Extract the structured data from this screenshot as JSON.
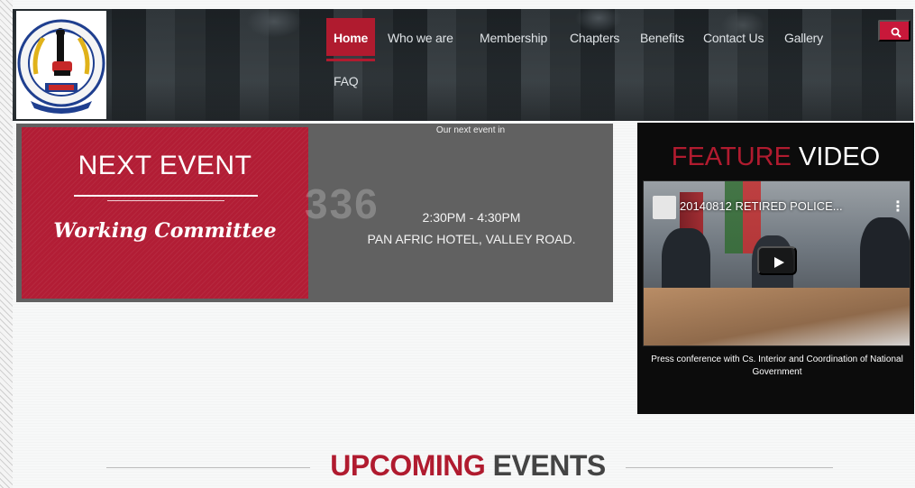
{
  "brand": {
    "logo_ring_text": "NATIONAL ASSOCIATION OF RETIRED POLICE OFFICERS",
    "logo_country": "KENYA",
    "logo_motto": "Utu Usalama"
  },
  "nav": {
    "items": [
      {
        "label": "Home",
        "active": true
      },
      {
        "label": "Who we are"
      },
      {
        "label": "Membership"
      },
      {
        "label": "Chapters"
      },
      {
        "label": "Benefits"
      },
      {
        "label": "Contact Us"
      },
      {
        "label": "Gallery"
      },
      {
        "label": "FAQ"
      }
    ],
    "search_icon": "search-icon"
  },
  "next_event": {
    "title": "NEXT EVENT",
    "name": "Working Committee",
    "caption": "Our next event in",
    "countdown": "336",
    "time": "2:30PM - 4:30PM",
    "venue": "PAN AFRIC HOTEL, VALLEY ROAD."
  },
  "feature_video": {
    "title_part1": "FEATURE",
    "title_part2": "VIDEO",
    "video_title": "20140812 RETIRED POLICE...",
    "menu_icon": "⋮",
    "caption": "Press conference with Cs. Interior and Coordination of National Government"
  },
  "upcoming": {
    "part1": "UPCOMING",
    "part2": "EVENTS"
  },
  "colors": {
    "accent": "#b01b2f",
    "dark": "#0c0c0c",
    "band": "#616161"
  }
}
